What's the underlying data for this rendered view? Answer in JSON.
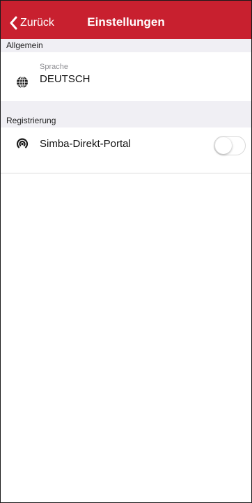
{
  "navbar": {
    "back_label": "Zurück",
    "title": "Einstellungen",
    "background_color": "#c8202f",
    "back_icon": "chevron-left-icon"
  },
  "sections": {
    "general": {
      "header": "Allgemein",
      "language": {
        "caption": "Sprache",
        "value": "DEUTSCH",
        "icon": "globe-icon"
      }
    },
    "registration": {
      "header": "Registrierung",
      "portal": {
        "label": "Simba-Direkt-Portal",
        "icon": "signal-icon",
        "enabled": false
      }
    }
  }
}
